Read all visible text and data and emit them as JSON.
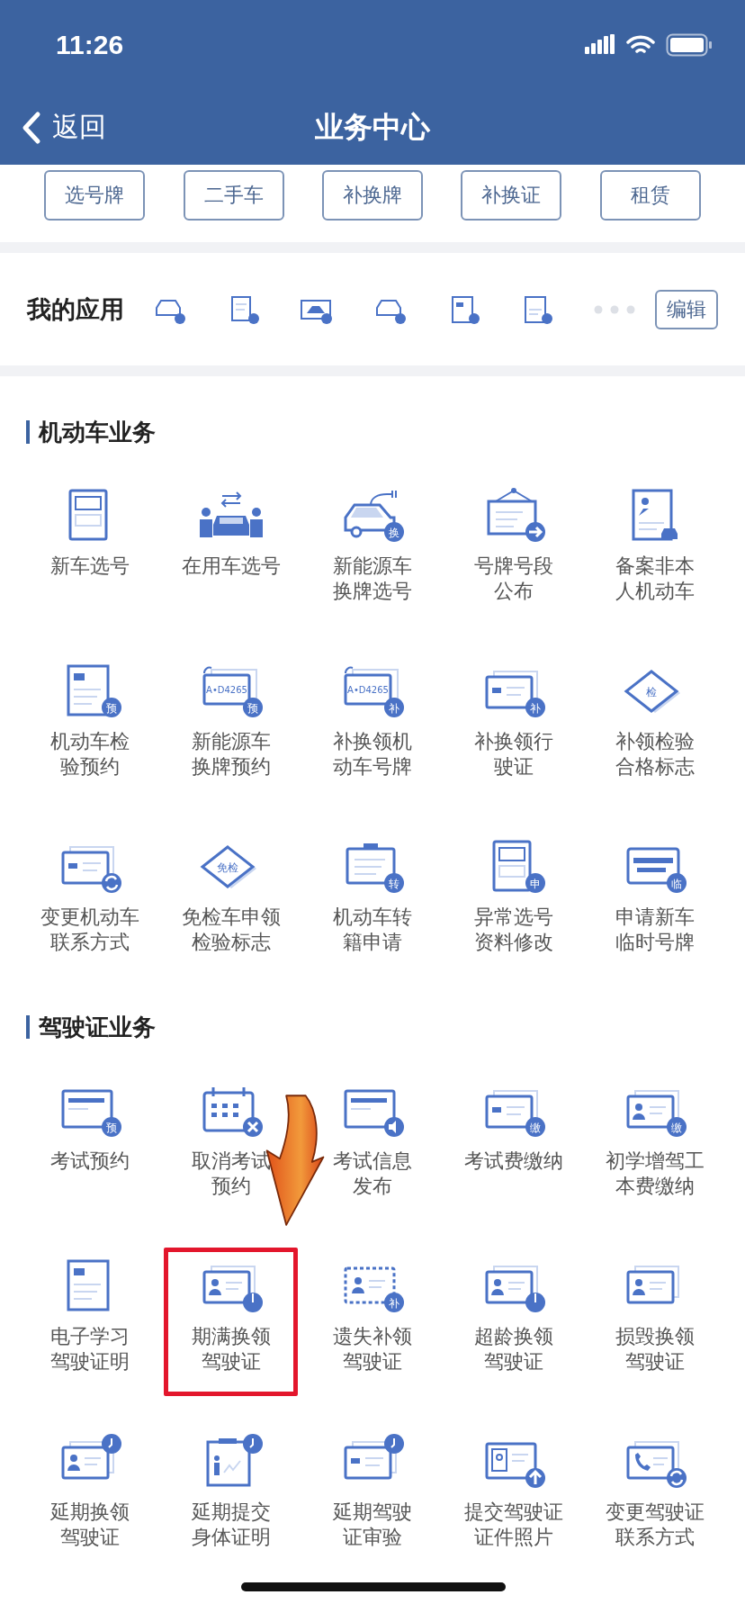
{
  "status_bar": {
    "time": "11:26"
  },
  "nav": {
    "back": "返回",
    "title": "业务中心"
  },
  "quick_buttons": [
    "选号牌",
    "二手车",
    "补换牌",
    "补换证",
    "租赁"
  ],
  "my_apps": {
    "title": "我的应用",
    "icons": [
      {
        "kind": "car"
      },
      {
        "kind": "scroll"
      },
      {
        "kind": "plate"
      },
      {
        "kind": "car"
      },
      {
        "kind": "doc"
      },
      {
        "kind": "cert"
      }
    ],
    "edit": "编辑"
  },
  "sections": [
    {
      "title": "机动车业务",
      "items": [
        {
          "lines": [
            "新车选号"
          ],
          "kind": "sheet"
        },
        {
          "lines": [
            "在用车选号"
          ],
          "kind": "people"
        },
        {
          "lines": [
            "新能源车",
            "换牌选号"
          ],
          "kind": "car",
          "badge": {
            "kind": "text",
            "text": "换"
          }
        },
        {
          "lines": [
            "号牌号段",
            "公布"
          ],
          "kind": "sign",
          "badge": {
            "kind": "arrow"
          }
        },
        {
          "lines": [
            "备案非本",
            "人机动车"
          ],
          "kind": "cert"
        },
        {
          "lines": [
            "机动车检",
            "验预约"
          ],
          "kind": "doc",
          "badge": {
            "kind": "text",
            "text": "预"
          }
        },
        {
          "lines": [
            "新能源车",
            "换牌预约"
          ],
          "kind": "plate",
          "plate": "A•D4265",
          "badge": {
            "kind": "text",
            "text": "预"
          }
        },
        {
          "lines": [
            "补换领机",
            "动车号牌"
          ],
          "kind": "plate",
          "plate": "A•D4265",
          "badge": {
            "kind": "text",
            "text": "补"
          }
        },
        {
          "lines": [
            "补换领行",
            "驶证"
          ],
          "kind": "card",
          "badge": {
            "kind": "text",
            "text": "补"
          }
        },
        {
          "lines": [
            "补领检验",
            "合格标志"
          ],
          "kind": "diamond",
          "tag": "检"
        },
        {
          "lines": [
            "变更机动车",
            "联系方式"
          ],
          "kind": "card",
          "badge": {
            "kind": "sync"
          }
        },
        {
          "lines": [
            "免检车申领",
            "检验标志"
          ],
          "kind": "diamond",
          "tag": "免检"
        },
        {
          "lines": [
            "机动车转",
            "籍申请"
          ],
          "kind": "board",
          "badge": {
            "kind": "text",
            "text": "转"
          }
        },
        {
          "lines": [
            "异常选号",
            "资料修改"
          ],
          "kind": "sheet",
          "badge": {
            "kind": "text",
            "text": "申"
          }
        },
        {
          "lines": [
            "申请新车",
            "临时号牌"
          ],
          "kind": "bars",
          "badge": {
            "kind": "text",
            "text": "临"
          }
        }
      ]
    },
    {
      "title": "驾驶证业务",
      "items": [
        {
          "lines": [
            "考试预约"
          ],
          "kind": "notice",
          "badge": {
            "kind": "text",
            "text": "预"
          },
          "highlighted": false
        },
        {
          "lines": [
            "取消考试",
            "预约"
          ],
          "kind": "calendar",
          "badge": {
            "kind": "x"
          },
          "highlighted": false
        },
        {
          "lines": [
            "考试信息",
            "发布"
          ],
          "kind": "notice",
          "badge": {
            "kind": "sound"
          },
          "highlighted": false
        },
        {
          "lines": [
            "考试费缴纳"
          ],
          "kind": "card",
          "badge": {
            "kind": "text",
            "text": "缴"
          },
          "highlighted": false
        },
        {
          "lines": [
            "初学增驾工",
            "本费缴纳"
          ],
          "kind": "idcard",
          "badge": {
            "kind": "text",
            "text": "缴"
          },
          "highlighted": false
        },
        {
          "lines": [
            "电子学习",
            "驾驶证明"
          ],
          "kind": "doc",
          "highlighted": false
        },
        {
          "lines": [
            "期满换领",
            "驾驶证"
          ],
          "kind": "idcard",
          "badge": {
            "kind": "timer"
          },
          "highlighted": true
        },
        {
          "lines": [
            "遗失补领",
            "驾驶证"
          ],
          "kind": "dashed",
          "badge": {
            "kind": "text",
            "text": "补"
          },
          "highlighted": false
        },
        {
          "lines": [
            "超龄换领",
            "驾驶证"
          ],
          "kind": "idcard",
          "badge": {
            "kind": "timer"
          },
          "highlighted": false
        },
        {
          "lines": [
            "损毁换领",
            "驾驶证"
          ],
          "kind": "idcard",
          "highlighted": false
        },
        {
          "lines": [
            "延期换领",
            "驾驶证"
          ],
          "kind": "idcard",
          "badge": {
            "kind": "clock"
          },
          "highlighted": false
        },
        {
          "lines": [
            "延期提交",
            "身体证明"
          ],
          "kind": "health",
          "badge": {
            "kind": "clock"
          },
          "highlighted": false
        },
        {
          "lines": [
            "延期驾驶",
            "证审验"
          ],
          "kind": "card",
          "badge": {
            "kind": "clock"
          },
          "highlighted": false
        },
        {
          "lines": [
            "提交驾驶证",
            "证件照片"
          ],
          "kind": "photo",
          "badge": {
            "kind": "upload"
          },
          "highlighted": false
        },
        {
          "lines": [
            "变更驾驶证",
            "联系方式"
          ],
          "kind": "phone",
          "badge": {
            "kind": "sync"
          },
          "highlighted": false
        }
      ]
    }
  ]
}
